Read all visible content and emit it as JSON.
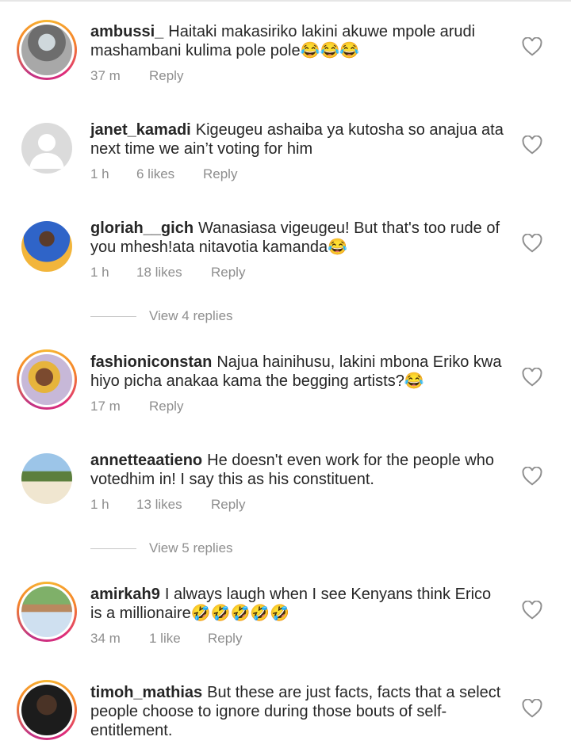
{
  "comments": [
    {
      "username": "ambussi_",
      "text": "Haitaki makasiriko lakini akuwe mpole arudi mashambani kulima pole pole😂😂😂",
      "time": "37 m",
      "likes": "",
      "reply": "Reply",
      "avatar": "photo-ring"
    },
    {
      "username": "janet_kamadi",
      "text": "Kigeugeu ashaiba  ya kutosha so anajua ata next time we ain’t voting for him",
      "time": "1 h",
      "likes": "6 likes",
      "reply": "Reply",
      "avatar": "default-silhouette"
    },
    {
      "username": "gloriah__gich",
      "text": "Wanasiasa vigeugeu! But that's too rude of you mhesh!ata nitavotia kamanda😂",
      "time": "1 h",
      "likes": "18 likes",
      "reply": "Reply",
      "avatar": "photo"
    },
    {
      "username": "fashioniconstan",
      "text": "Najua hainihusu, lakini mbona Eriko kwa hiyo picha anakaa kama the begging artists?😂",
      "time": "17 m",
      "likes": "",
      "reply": "Reply",
      "avatar": "photo-ring"
    },
    {
      "username": "annetteaatieno",
      "text": "He doesn't even work for the people who votedhim in! I say this as his constituent.",
      "time": "1 h",
      "likes": "13 likes",
      "reply": "Reply",
      "avatar": "photo"
    },
    {
      "username": "amirkah9",
      "text": "I always laugh when I see Kenyans think Erico is a millionaire🤣🤣🤣🤣🤣",
      "time": "34 m",
      "likes": "1 like",
      "reply": "Reply",
      "avatar": "photo-ring"
    },
    {
      "username": "timoh_mathias",
      "text": "But these are just facts, facts that a select people choose to ignore during those bouts of self-entitlement.",
      "time": "",
      "likes": "",
      "reply": "",
      "avatar": "photo-ring"
    }
  ],
  "view_replies": [
    "View 4 replies",
    "View 5 replies"
  ],
  "icons": {
    "like": "heart-outline-icon"
  },
  "colors": {
    "meta_gray": "#8e8e8e",
    "text": "#262626"
  }
}
